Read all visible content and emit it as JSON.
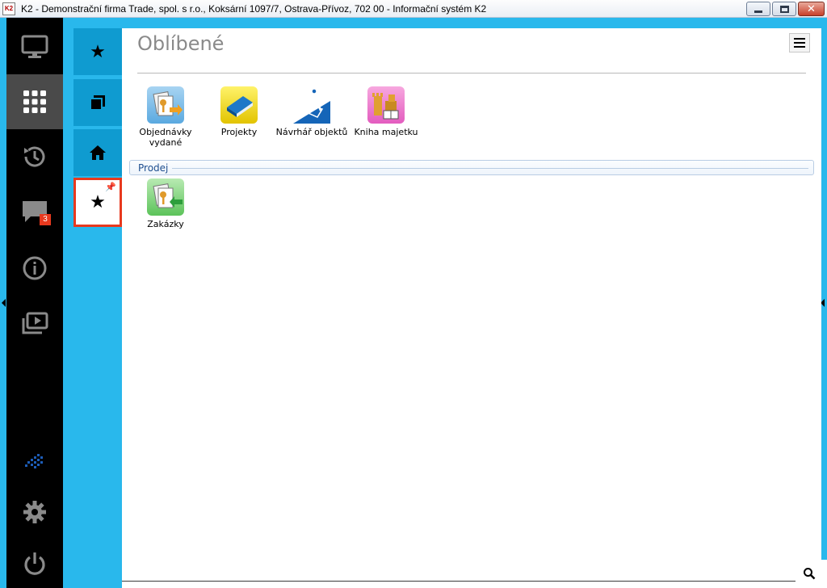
{
  "window": {
    "title": "K2 - Demonstrační firma Trade, spol. s r.o., Koksární 1097/7, Ostrava-Přívoz, 702 00 - Informační systém K2",
    "app_icon": "K2",
    "buttons": [
      "minimize",
      "maximize",
      "close"
    ]
  },
  "sidebar": {
    "items": [
      {
        "icon": "monitor-icon"
      },
      {
        "icon": "grid-icon",
        "active": true
      },
      {
        "icon": "history-icon"
      },
      {
        "icon": "chat-icon",
        "badge": "3"
      },
      {
        "icon": "info-icon"
      },
      {
        "icon": "media-icon"
      }
    ],
    "bottom": [
      {
        "icon": "k2-logo-icon"
      },
      {
        "icon": "gear-icon"
      },
      {
        "icon": "power-icon"
      }
    ]
  },
  "tabs": [
    {
      "icon": "star-icon"
    },
    {
      "icon": "windows-icon"
    },
    {
      "icon": "home-icon"
    },
    {
      "icon": "star-icon",
      "selected": true,
      "pinned": true
    }
  ],
  "main": {
    "title": "Oblíbené",
    "favorites": [
      {
        "label": "Objednávky vydané",
        "icon": "orders-issued-icon"
      },
      {
        "label": "Projekty",
        "icon": "projects-book-icon"
      },
      {
        "label": "Návrhář objektů",
        "icon": "object-designer-icon"
      },
      {
        "label": "Kniha majetku",
        "icon": "asset-book-icon"
      }
    ],
    "groups": [
      {
        "name": "Prodej",
        "items": [
          {
            "label": "Zakázky",
            "icon": "orders-icon"
          }
        ]
      }
    ]
  },
  "colors": {
    "background": "#29b8ec",
    "tab": "#0f9bd0",
    "sidebar": "#000000",
    "selection_border": "#e8391e",
    "badge": "#e8391e"
  }
}
